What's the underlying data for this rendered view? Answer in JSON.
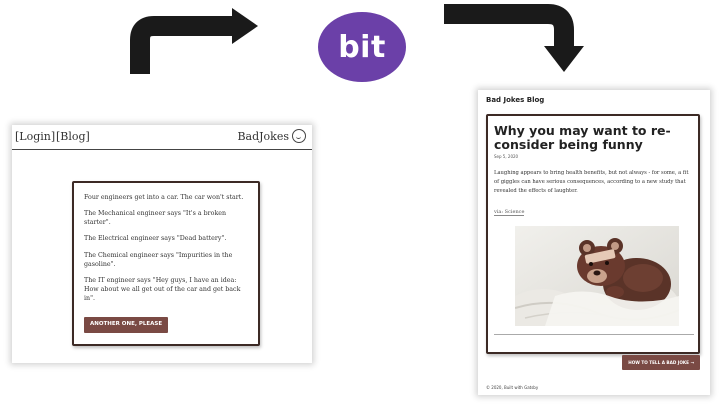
{
  "logo": {
    "text": "bit",
    "color": "#6b40a8"
  },
  "arrows": [
    {
      "name": "arrow-up-right-icon",
      "color": "#1a1a1a"
    },
    {
      "name": "arrow-right-down-icon",
      "color": "#1a1a1a"
    }
  ],
  "left_app": {
    "nav": {
      "login": "[Login]",
      "blog": "[Blog]",
      "brand": "BadJokes"
    },
    "joke_lines": [
      "Four engineers get into a car. The car won't start.",
      "The Mechanical engineer says \"It's a broken starter\".",
      "The Electrical engineer says \"Dead battery\".",
      "The Chemical engineer says \"Impurities in the gasoline\".",
      "The IT engineer says \"Hey guys, I have an idea: How about we all get out of the car and get back in\"."
    ],
    "another_button": "ANOTHER ONE, PLEASE",
    "accent_color": "#7a4a44"
  },
  "right_app": {
    "blog_title": "Bad Jokes Blog",
    "post": {
      "title": "Why you may want to re-consider being funny",
      "date": "Sep 5, 2020",
      "body": "Laughing appears to bring health benefits, but not always - for some, a fit of giggles can have serious consequences, according to a new study that revealed the effects of laughter.",
      "via": "via: Science",
      "image": "teddy-bear-photo"
    },
    "next_button": "HOW TO TELL A BAD JOKE →",
    "footer": "© 2020, Built with Gatsby"
  }
}
